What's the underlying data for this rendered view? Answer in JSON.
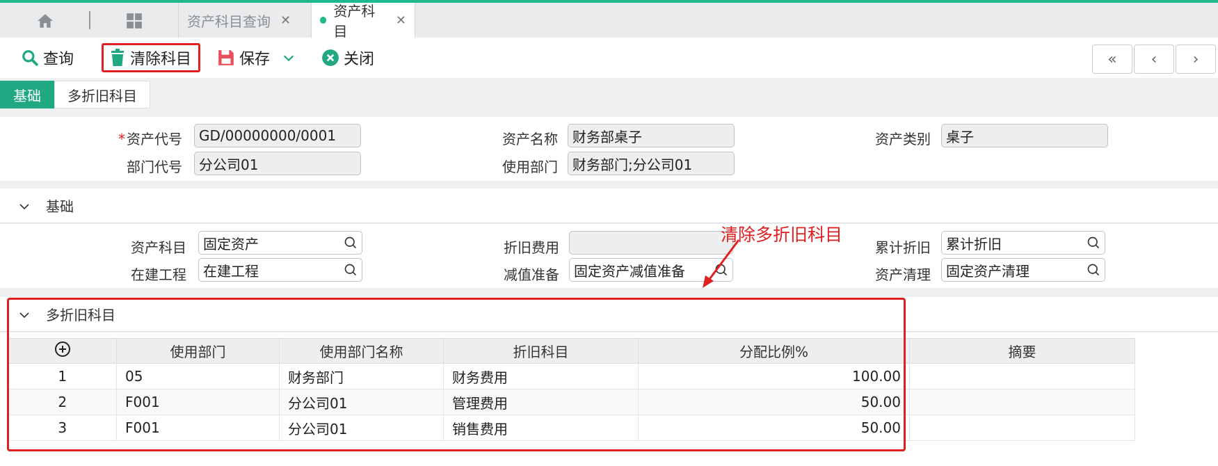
{
  "tabs": [
    {
      "label": "资产科目查询",
      "active": false
    },
    {
      "label": "资产科目",
      "active": true
    }
  ],
  "toolbar": {
    "query": "查询",
    "clear": "清除科目",
    "save": "保存",
    "close": "关闭"
  },
  "subtabs": [
    "基础",
    "多折旧科目"
  ],
  "header": {
    "asset_code_label": "资产代号",
    "asset_code": "GD/00000000/0001",
    "asset_name_label": "资产名称",
    "asset_name": "财务部桌子",
    "asset_type_label": "资产类别",
    "asset_type": "桌子",
    "dept_code_label": "部门代号",
    "dept_code": "分公司01",
    "use_dept_label": "使用部门",
    "use_dept": "财务部门;分公司01"
  },
  "basic": {
    "title": "基础",
    "asset_subject_label": "资产科目",
    "asset_subject": "固定资产",
    "dep_expense_label": "折旧费用",
    "dep_expense": "",
    "acc_dep_label": "累计折旧",
    "acc_dep": "累计折旧",
    "construction_label": "在建工程",
    "construction": "在建工程",
    "impairment_label": "减值准备",
    "impairment": "固定资产减值准备",
    "disposal_label": "资产清理",
    "disposal": "固定资产清理"
  },
  "multi": {
    "title": "多折旧科目",
    "columns": [
      "使用部门",
      "使用部门名称",
      "折旧科目",
      "分配比例%",
      "摘要"
    ],
    "rows": [
      {
        "idx": "1",
        "dept": "05",
        "dept_name": "财务部门",
        "subject": "财务费用",
        "ratio": "100.00",
        "memo": ""
      },
      {
        "idx": "2",
        "dept": "F001",
        "dept_name": "分公司01",
        "subject": "管理费用",
        "ratio": "50.00",
        "memo": ""
      },
      {
        "idx": "3",
        "dept": "F001",
        "dept_name": "分公司01",
        "subject": "销售费用",
        "ratio": "50.00",
        "memo": ""
      }
    ]
  },
  "annotation": "清除多折旧科目",
  "colors": {
    "accent": "#20b98c",
    "highlight": "#e02020"
  }
}
